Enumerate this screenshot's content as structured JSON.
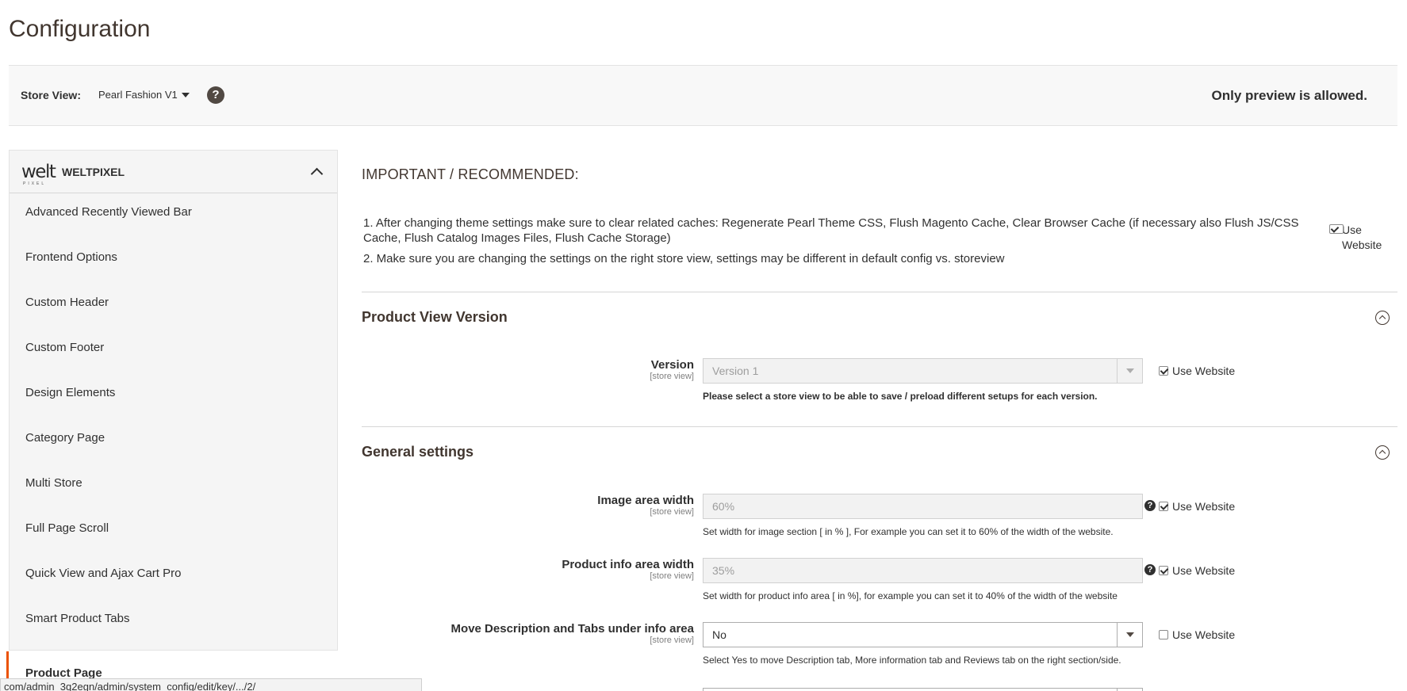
{
  "page": {
    "title": "Configuration"
  },
  "store_bar": {
    "label": "Store View:",
    "selected": "Pearl Fashion V1",
    "help_icon": "?",
    "preview_note": "Only preview is allowed."
  },
  "sidebar": {
    "logo": "welt",
    "logo_sub": "PIXEL",
    "title": "WELTPIXEL",
    "items": [
      {
        "label": "Advanced Recently Viewed Bar"
      },
      {
        "label": "Frontend Options"
      },
      {
        "label": "Custom Header"
      },
      {
        "label": "Custom Footer"
      },
      {
        "label": "Design Elements"
      },
      {
        "label": "Category Page"
      },
      {
        "label": "Multi Store"
      },
      {
        "label": "Full Page Scroll"
      },
      {
        "label": "Quick View and Ajax Cart Pro"
      },
      {
        "label": "Smart Product Tabs"
      },
      {
        "label": "Product Page"
      }
    ]
  },
  "status_url": "com/admin_3q2egn/admin/system_config/edit/key/.../2/",
  "important": {
    "title": "IMPORTANT / RECOMMENDED:",
    "line1": "1. After changing theme settings make sure to clear related caches: Regenerate Pearl Theme CSS, Flush Magento Cache, Clear Browser Cache (if necessary also Flush JS/CSS Cache, Flush Catalog Images Files, Flush Cache Storage)",
    "line2": "2. Make sure you are changing the settings on the right store view, settings may be different in default config vs. storeview",
    "use_website_1": "Use",
    "use_website_2": "Website"
  },
  "sections": {
    "product_view": {
      "title": "Product View Version",
      "version_label": "Version",
      "scope": "[store view]",
      "version_value": "Version 1",
      "use_website": "Use Website",
      "note": "Please select a store view to be able to save / preload different setups for each version."
    },
    "general": {
      "title": "General settings",
      "image_area": {
        "label": "Image area width",
        "scope": "[store view]",
        "value": "60%",
        "use_website": "Use Website",
        "note": "Set width for image section [ in % ], For example you can set it to 60% of the width of the website."
      },
      "info_area": {
        "label": "Product info area width",
        "scope": "[store view]",
        "value": "35%",
        "use_website": "Use Website",
        "note": "Set width for product info area [ in %], for example you can set it to 40% of the width of the website"
      },
      "move_desc": {
        "label": "Move Description and Tabs under info area",
        "scope": "[store view]",
        "value": "No",
        "use_website": "Use Website",
        "note": "Select Yes to move Description tab, More information tab and Reviews tab on the right section/side."
      }
    }
  }
}
